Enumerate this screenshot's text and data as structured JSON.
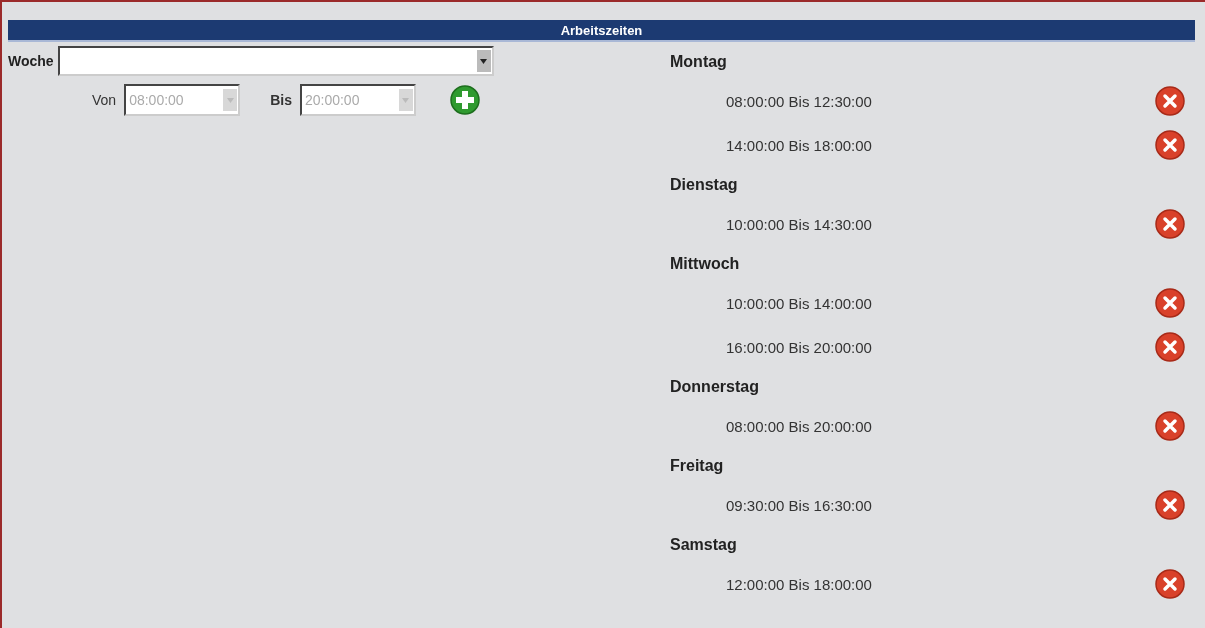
{
  "header": {
    "title": "Arbeitszeiten"
  },
  "form": {
    "week_label": "Woche",
    "from_label": "Von",
    "from_value": "08:00:00",
    "from_disabled": true,
    "to_label": "Bis",
    "to_value": "20:00:00",
    "to_disabled": true
  },
  "days": [
    {
      "name": "Montag",
      "slots": [
        {
          "text": "08:00:00 Bis 12:30:00"
        },
        {
          "text": "14:00:00 Bis 18:00:00"
        }
      ]
    },
    {
      "name": "Dienstag",
      "slots": [
        {
          "text": "10:00:00 Bis 14:30:00"
        }
      ]
    },
    {
      "name": "Mittwoch",
      "slots": [
        {
          "text": "10:00:00 Bis 14:00:00"
        },
        {
          "text": "16:00:00 Bis 20:00:00"
        }
      ]
    },
    {
      "name": "Donnerstag",
      "slots": [
        {
          "text": "08:00:00 Bis 20:00:00"
        }
      ]
    },
    {
      "name": "Freitag",
      "slots": [
        {
          "text": "09:30:00 Bis 16:30:00"
        }
      ]
    },
    {
      "name": "Samstag",
      "slots": [
        {
          "text": "12:00:00 Bis 18:00:00"
        }
      ]
    }
  ]
}
